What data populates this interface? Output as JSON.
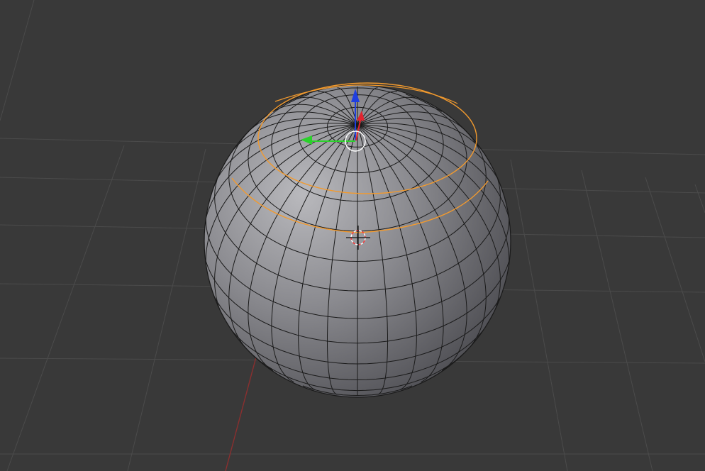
{
  "viewport": {
    "title": "",
    "background_color": "#393939",
    "grid_line_color": "#4b4b4b",
    "x_axis_color": "#8a2f2f"
  },
  "mesh": {
    "type": "uv-sphere",
    "segments": 32,
    "rings": 16,
    "face_color": "#8a8a8e",
    "edge_color": "#111111",
    "selected_edge_loop_color": "#f29a2e"
  },
  "gizmo": {
    "mode": "translate",
    "x_axis_color": "#e1242f",
    "y_axis_color": "#2bd12b",
    "z_axis_color": "#1f3fe0",
    "center_ring_color": "#ffffff"
  },
  "cursor_3d": {
    "name": "3d-cursor",
    "ring_colors": [
      "#ff3333",
      "#ffffff"
    ]
  }
}
